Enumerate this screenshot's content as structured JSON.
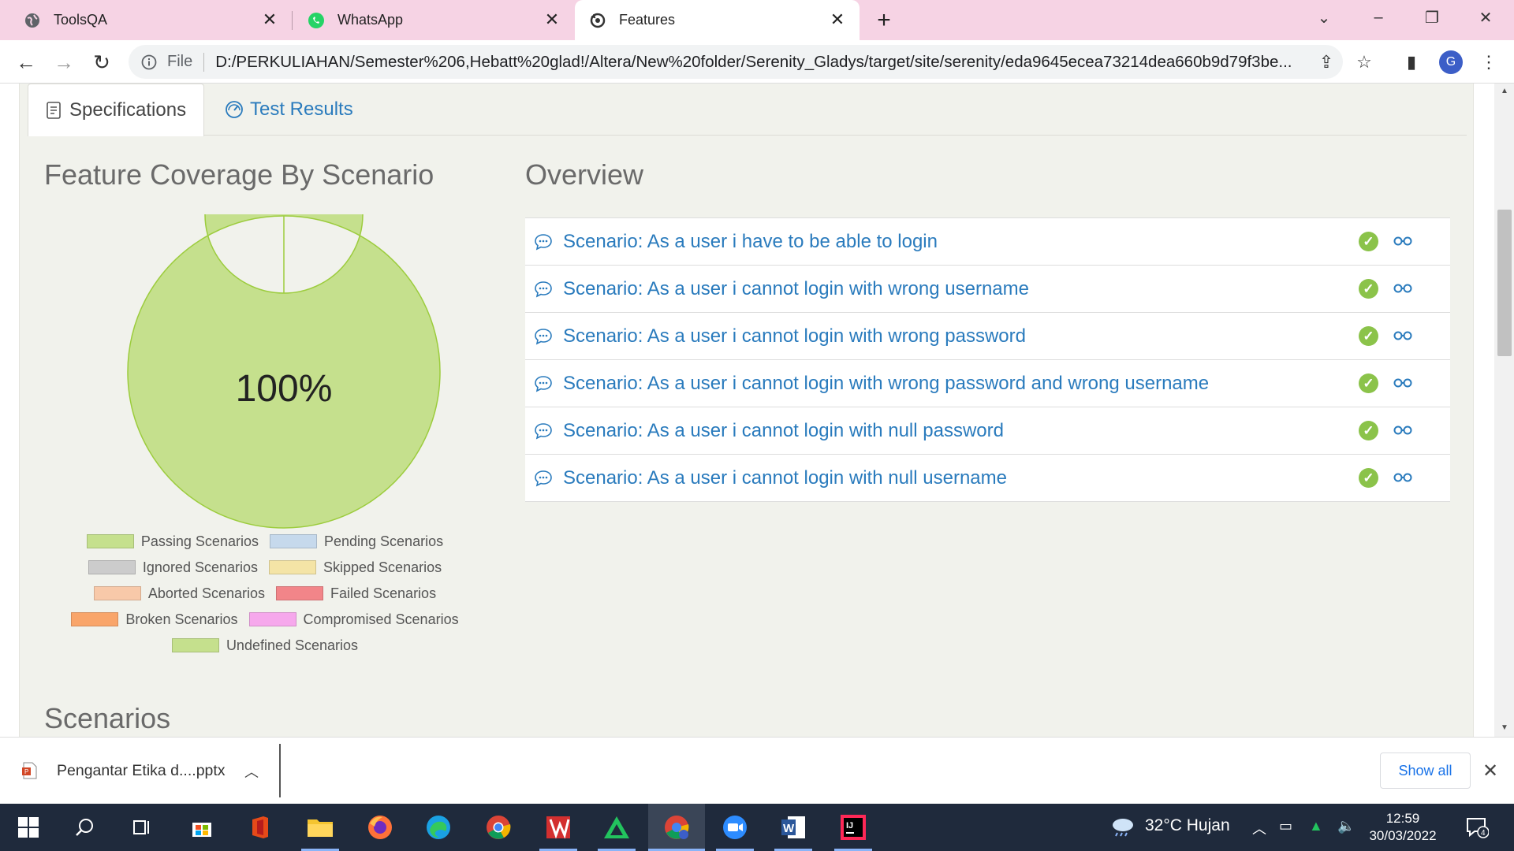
{
  "browser": {
    "tabs": [
      {
        "title": "ToolsQA",
        "icon": "globe-icon"
      },
      {
        "title": "WhatsApp",
        "icon": "whatsapp-icon"
      },
      {
        "title": "Features",
        "icon": "serenity-icon",
        "active": true
      }
    ],
    "address": {
      "scheme": "File",
      "url": "D:/PERKULIAHAN/Semester%206,Hebatt%20glad!/Altera/New%20folder/Serenity_Gladys/target/site/serenity/eda9645ecea73214dea660b9d79f3be..."
    },
    "profile_initial": "G"
  },
  "page": {
    "tabs": {
      "specifications": "Specifications",
      "test_results": "Test Results"
    },
    "coverage_title": "Feature Coverage By Scenario",
    "overview_title": "Overview",
    "scenarios_heading": "Scenarios",
    "overview_items": [
      "Scenario: As a user i have to be able to login",
      "Scenario: As a user i cannot login with wrong username",
      "Scenario: As a user i cannot login with wrong password",
      "Scenario: As a user i cannot login with wrong password and wrong username",
      "Scenario: As a user i cannot login with null password",
      "Scenario: As a user i cannot login with null username"
    ],
    "legend_rows": [
      [
        {
          "label": "Passing Scenarios",
          "color": "#c5e08d"
        },
        {
          "label": "Pending Scenarios",
          "color": "#c6d9ec"
        }
      ],
      [
        {
          "label": "Ignored Scenarios",
          "color": "#cccccc"
        },
        {
          "label": "Skipped Scenarios",
          "color": "#f4e4a6"
        }
      ],
      [
        {
          "label": "Aborted Scenarios",
          "color": "#f8c9a9"
        },
        {
          "label": "Failed Scenarios",
          "color": "#f28589"
        }
      ],
      [
        {
          "label": "Broken Scenarios",
          "color": "#f9a56a"
        },
        {
          "label": "Compromised Scenarios",
          "color": "#f6a8ec"
        }
      ],
      [
        {
          "label": "Undefined Scenarios",
          "color": "#c5e08d"
        }
      ]
    ]
  },
  "chart_data": {
    "type": "pie",
    "variant": "donut",
    "center_label": "100%",
    "categories": [
      "Passing Scenarios",
      "Pending Scenarios",
      "Ignored Scenarios",
      "Skipped Scenarios",
      "Aborted Scenarios",
      "Failed Scenarios",
      "Broken Scenarios",
      "Compromised Scenarios",
      "Undefined Scenarios"
    ],
    "values": [
      6,
      0,
      0,
      0,
      0,
      0,
      0,
      0,
      0
    ],
    "colors": [
      "#c5e08d",
      "#c6d9ec",
      "#cccccc",
      "#f4e4a6",
      "#f8c9a9",
      "#f28589",
      "#f9a56a",
      "#f6a8ec",
      "#c5e08d"
    ]
  },
  "downloads": {
    "file": "Pengantar Etika d....pptx",
    "show_all": "Show all"
  },
  "taskbar": {
    "weather": "32°C  Hujan",
    "time": "12:59",
    "date": "30/03/2022",
    "notification_count": "4"
  }
}
